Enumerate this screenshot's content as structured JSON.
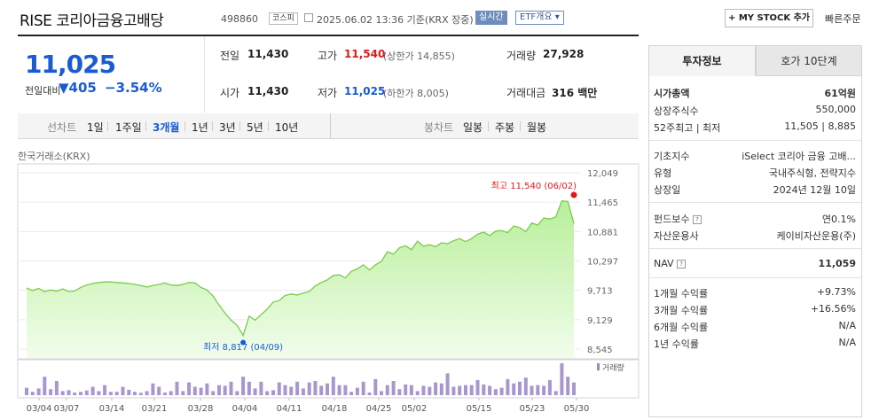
{
  "header": {
    "name": "RISE 코리아금융고배당",
    "code": "498860",
    "market": "코스피",
    "datetime": "2025.06.02 13:36 기준(KRX 장중)",
    "realtime_label": "실시간",
    "etf_label": "ETF개요 ▾",
    "mystock_label": "+ MY STOCK 추가",
    "quick_order_label": "빠른주문"
  },
  "price": {
    "current": "11,025",
    "change_label": "전일대비",
    "change": "▼405",
    "percent": "−3.54%"
  },
  "stats": {
    "prev_label": "전일",
    "prev": "11,430",
    "high_label": "고가",
    "high": "11,540",
    "upper_limit": "(상한가 14,855)",
    "volume_label": "거래량",
    "volume": "27,928",
    "open_label": "시가",
    "open": "11,430",
    "low_label": "저가",
    "low": "11,025",
    "lower_limit": "(하한가 8,005)",
    "amount_label": "거래대금",
    "amount": "316 백만"
  },
  "toolbar": {
    "line_label": "선차트",
    "periods": [
      "1일",
      "1주일",
      "3개월",
      "1년",
      "3년",
      "5년",
      "10년"
    ],
    "selected": "3개월",
    "candle_label": "봉차트",
    "candle_periods": [
      "일봉",
      "주봉",
      "월봉"
    ]
  },
  "exchange_label": "한국거래소(KRX)",
  "chart_data": {
    "type": "area",
    "y_ticks": [
      "12,049",
      "11,465",
      "10,881",
      "10,297",
      "9,713",
      "9,129",
      "8,545"
    ],
    "ylim": [
      8545,
      12049
    ],
    "x_tick_labels": [
      "03/04",
      "03/07",
      "03/14",
      "03/21",
      "03/28",
      "04/04",
      "04/11",
      "04/18",
      "04/25",
      "05/02",
      "05/15",
      "05/23",
      "05/30"
    ],
    "max_label": "최고 11,540 (06/02)",
    "min_label": "최저 8,817 (04/09)",
    "volume_legend": "거래량",
    "values": [
      9760,
      9710,
      9750,
      9690,
      9720,
      9700,
      9740,
      9690,
      9700,
      9770,
      9820,
      9850,
      9870,
      9880,
      9880,
      9870,
      9860,
      9850,
      9830,
      9810,
      9780,
      9810,
      9830,
      9860,
      9820,
      9810,
      9830,
      9870,
      9860,
      9770,
      9720,
      9600,
      9420,
      9260,
      9120,
      9020,
      8817,
      9200,
      9120,
      9230,
      9340,
      9480,
      9510,
      9610,
      9640,
      9620,
      9660,
      9690,
      9800,
      9870,
      9920,
      10010,
      10020,
      9960,
      10090,
      10140,
      10220,
      10120,
      10220,
      10290,
      10480,
      10430,
      10560,
      10600,
      10520,
      10690,
      10590,
      10620,
      10580,
      10660,
      10640,
      10700,
      10740,
      10680,
      10740,
      10830,
      10870,
      10800,
      10890,
      10900,
      10860,
      10990,
      10960,
      10880,
      11050,
      11010,
      11150,
      11130,
      11170,
      11490,
      11480,
      11040
    ],
    "volumes": [
      0.22,
      0.1,
      0.2,
      0.55,
      0.18,
      0.42,
      0.12,
      0.15,
      0.08,
      0.1,
      0.14,
      0.25,
      0.12,
      0.3,
      0.1,
      0.1,
      0.25,
      0.16,
      0.1,
      0.07,
      0.12,
      0.35,
      0.25,
      0.08,
      0.12,
      0.4,
      0.12,
      0.38,
      0.25,
      0.22,
      0.35,
      0.12,
      0.3,
      0.28,
      0.4,
      0.12,
      0.55,
      0.4,
      0.2,
      0.4,
      0.12,
      0.15,
      0.38,
      0.3,
      0.25,
      0.4,
      0.2,
      0.38,
      0.42,
      0.28,
      0.35,
      0.55,
      0.3,
      0.3,
      0.1,
      0.22,
      0.4,
      0.08,
      0.48,
      0.12,
      0.3,
      0.42,
      0.18,
      0.32,
      0.3,
      0.12,
      0.28,
      0.25,
      0.38,
      0.35,
      0.65,
      0.25,
      0.28,
      0.3,
      0.3,
      0.45,
      0.32,
      0.28,
      0.18,
      0.22,
      0.48,
      0.35,
      0.4,
      0.52,
      0.28,
      0.3,
      0.28,
      0.45,
      0.12,
      0.95,
      0.55,
      0.38
    ]
  },
  "panel": {
    "tab_active": "투자정보",
    "tab_other": "호가 10단계",
    "rows_a": [
      {
        "label": "시가총액",
        "value": "61억원"
      },
      {
        "label": "상장주식수",
        "value": "550,000"
      },
      {
        "label": "52주최고 | 최저",
        "value": "11,505 | 8,885"
      }
    ],
    "rows_b": [
      {
        "label": "기초지수",
        "value": "iSelect 코리아 금융 고배..."
      },
      {
        "label": "유형",
        "value": "국내주식형, 전략지수"
      },
      {
        "label": "상장일",
        "value": "2024년 12월 10일"
      }
    ],
    "rows_c": [
      {
        "label": "펀드보수",
        "value": "연0.1%"
      },
      {
        "label": "자산운용사",
        "value": "케이비자산운용(주)"
      }
    ],
    "nav": {
      "label": "NAV",
      "value": "11,059"
    },
    "returns": [
      {
        "label": "1개월 수익률",
        "value": "+9.73%"
      },
      {
        "label": "3개월 수익률",
        "value": "+16.56%"
      },
      {
        "label": "6개월 수익률",
        "value": "N/A"
      },
      {
        "label": "1년 수익률",
        "value": "N/A"
      }
    ]
  }
}
